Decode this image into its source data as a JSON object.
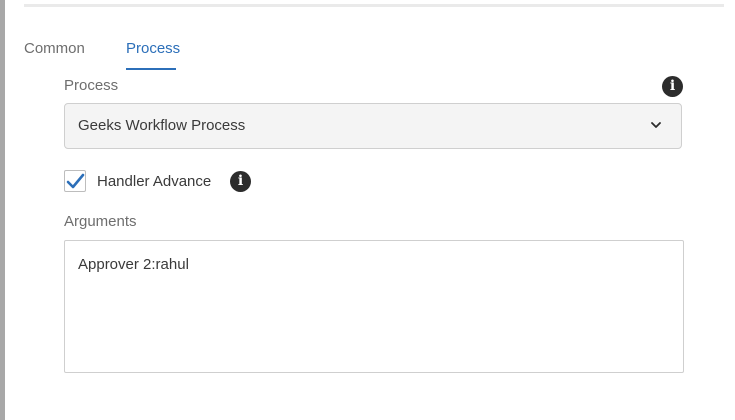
{
  "tabs": [
    {
      "label": "Common",
      "selected": false
    },
    {
      "label": "Process",
      "selected": true
    }
  ],
  "process_field": {
    "label": "Process",
    "selected_value": "Geeks Workflow Process",
    "info_icon": "info-icon",
    "dropdown_icon": "chevron-down-icon"
  },
  "handler_advance": {
    "label": "Handler Advance",
    "checked": true,
    "info_icon": "info-icon"
  },
  "arguments_field": {
    "label": "Arguments",
    "value": "Approver 2:rahul"
  },
  "colors": {
    "accent": "#2c6fb9",
    "text": "#3a3a3a",
    "muted_text": "#6e6e6e",
    "border": "#cfcfcf",
    "select_background": "#f4f4f4",
    "icon": "#2c2c2c"
  }
}
